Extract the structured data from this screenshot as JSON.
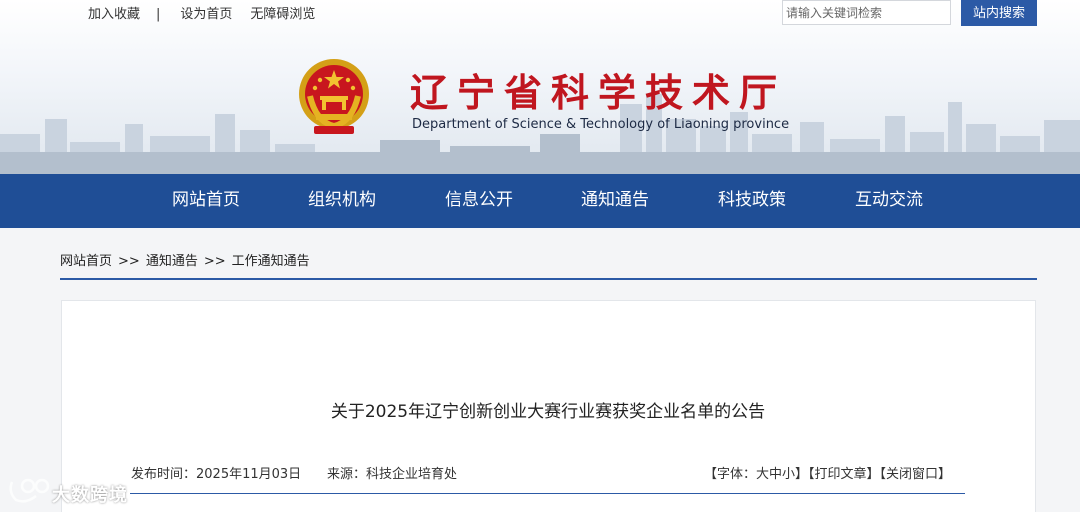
{
  "top_links": [
    "加入收藏",
    "|",
    "设为首页",
    "无障碍浏览"
  ],
  "search": {
    "placeholder": "请输入关键词检索",
    "button": "站内搜索"
  },
  "site": {
    "title_cn": "辽宁省科学技术厅",
    "title_en": "Department of Science & Technology of Liaoning province"
  },
  "nav": [
    "网站首页",
    "组织机构",
    "信息公开",
    "通知通告",
    "科技政策",
    "互动交流"
  ],
  "breadcrumb": [
    "网站首页",
    "通知通告",
    "工作通知通告"
  ],
  "breadcrumb_sep": ">>",
  "article": {
    "title": "关于2025年辽宁创新创业大赛行业赛获奖企业名单的公告",
    "date_label": "发布时间：",
    "date": "2025年11月03日",
    "source_label": "来源：",
    "source": "科技企业培育处",
    "font_label": "【字体：大中小】",
    "print_label": "【打印文章】",
    "close_label": "【关闭窗口】"
  },
  "watermark": "大数跨境",
  "colors": {
    "nav_blue": "#1f4e96",
    "title_red": "#c0161f",
    "accent_blue": "#2c5aa6"
  }
}
